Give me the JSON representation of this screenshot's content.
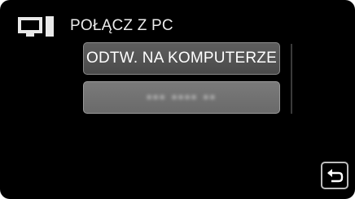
{
  "header": {
    "icon": "pc-icon",
    "title": "POŁĄCZ Z PC"
  },
  "menu": {
    "items": [
      {
        "label": "ODTW. NA KOMPUTERZE",
        "state": "enabled"
      },
      {
        "label": "▪▪▪ ▪▪▪▪ ▪▪",
        "state": "disabled"
      }
    ]
  },
  "controls": {
    "back_icon": "return-arrow-icon"
  },
  "colors": {
    "background": "#000000",
    "button": "#555555",
    "button_disabled": "#727272",
    "text": "#ffffff"
  }
}
